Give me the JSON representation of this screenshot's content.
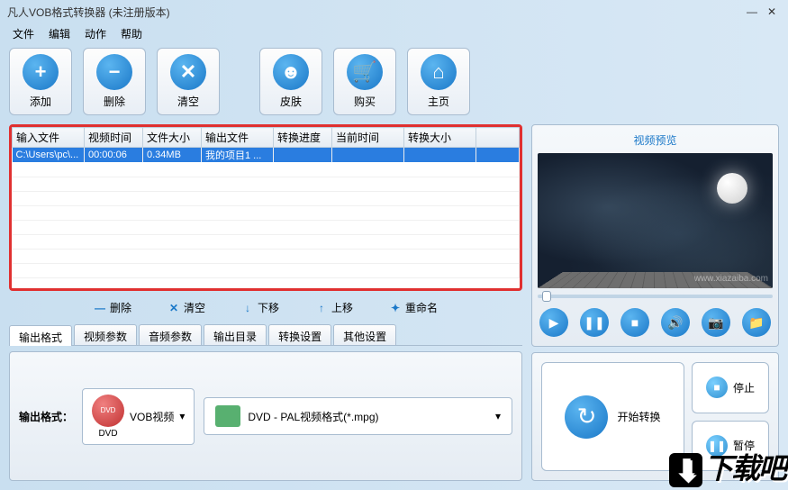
{
  "title": "凡人VOB格式转换器  (未注册版本)",
  "menu": {
    "file": "文件",
    "edit": "编辑",
    "action": "动作",
    "help": "帮助"
  },
  "toolbar": {
    "add": "添加",
    "delete": "删除",
    "clear": "清空",
    "skin": "皮肤",
    "buy": "购买",
    "home": "主页"
  },
  "table": {
    "headers": {
      "input": "输入文件",
      "vtime": "视频时间",
      "fsize": "文件大小",
      "output": "输出文件",
      "progress": "转换进度",
      "curtime": "当前时间",
      "outsize": "转换大小"
    },
    "row": {
      "input": "C:\\Users\\pc\\...",
      "vtime": "00:00:06",
      "fsize": "0.34MB",
      "output": "我的项目1 ...",
      "progress": "",
      "curtime": "",
      "outsize": ""
    }
  },
  "listops": {
    "delete": "删除",
    "clear": "清空",
    "down": "下移",
    "up": "上移",
    "rename": "重命名"
  },
  "tabs": {
    "fmt": "输出格式",
    "vparam": "视频参数",
    "aparam": "音频参数",
    "outdir": "输出目录",
    "convset": "转换设置",
    "other": "其他设置"
  },
  "output": {
    "label": "输出格式：",
    "vob": "VOB视频",
    "dvd": "DVD",
    "mpg": "DVD - PAL视频格式(*.mpg)"
  },
  "preview": {
    "title": "视频预览",
    "wm": "www.xiazaiba.com"
  },
  "convert": {
    "start": "开始转换",
    "stop": "停止",
    "pause": "暂停"
  },
  "watermark": "下载吧"
}
